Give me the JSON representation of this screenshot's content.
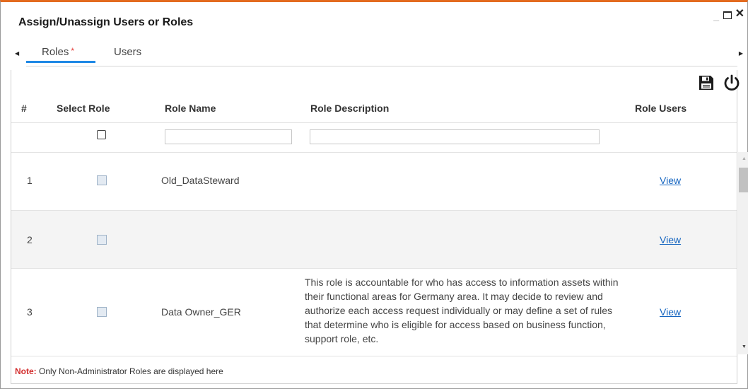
{
  "dialog": {
    "title": "Assign/Unassign Users or Roles"
  },
  "tabs": [
    {
      "label": "Roles",
      "required_mark": "*"
    },
    {
      "label": "Users"
    }
  ],
  "table": {
    "headers": {
      "num": "#",
      "select": "Select Role",
      "name": "Role Name",
      "description": "Role Description",
      "users": "Role Users"
    },
    "rows": [
      {
        "num": "1",
        "name": "Old_DataSteward",
        "description": "",
        "users_link": "View"
      },
      {
        "num": "2",
        "name": "",
        "description": "",
        "users_link": "View"
      },
      {
        "num": "3",
        "name": "Data Owner_GER",
        "description": "This role is accountable for who has access to information assets within their functional areas for Germany area. It may decide to review and authorize each access request individually or may define a set of rules that determine who is eligible for access based on business function, support role, etc.",
        "users_link": "View"
      }
    ]
  },
  "note": {
    "label": "Note:",
    "text": "Only Non-Administrator Roles are displayed here"
  },
  "icons": {
    "save": "save-icon",
    "power": "power-icon"
  },
  "colors": {
    "accent_border": "#e36b1f",
    "tab_underline": "#1e88e5",
    "link": "#1565c0",
    "note_label": "#d32f2f"
  }
}
